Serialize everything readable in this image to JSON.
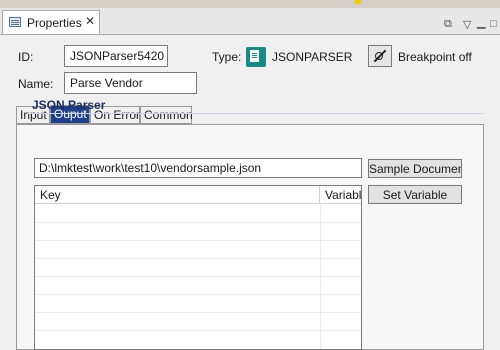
{
  "view": {
    "tab_label": "Properties",
    "close_glyph": "✕",
    "toolbar_icons": [
      "new-window-icon",
      "view-menu-icon",
      "minimize-icon",
      "maximize-icon"
    ]
  },
  "header": {
    "id_label": "ID:",
    "id_value": "JSONParser5420",
    "type_label": "Type:",
    "type_value": "JSONPARSER",
    "type_icon": "json-parser-icon",
    "breakpoint_label": "Breakpoint off",
    "breakpoint_icon": "breakpoint-off-icon",
    "name_label": "Name:",
    "name_value": "Parse Vendor"
  },
  "tabs": [
    {
      "label": "Input",
      "selected": false
    },
    {
      "label": "Ouput",
      "selected": true
    },
    {
      "label": "On Error",
      "selected": false
    },
    {
      "label": "Common",
      "selected": false
    }
  ],
  "section": {
    "title": "JSON Parser",
    "file_path": "D:\\lmktest\\work\\test10\\vendorsample.json",
    "sample_button": "Sample Document",
    "set_variable_button": "Set Variable"
  },
  "table": {
    "columns": [
      "Key",
      "Variable"
    ],
    "rows": []
  }
}
